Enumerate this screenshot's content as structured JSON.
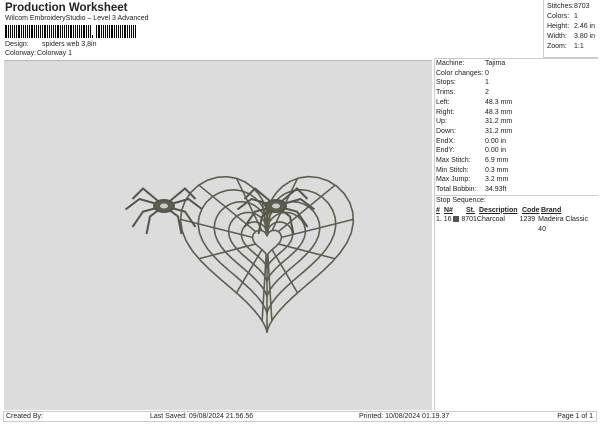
{
  "header": {
    "title": "Production Worksheet",
    "subtitle": "Wilcom EmbroideryStudio – Level 3 Advanced",
    "design_label": "Design:",
    "design_value": "spiders web 3,8in",
    "colorway_label": "Colorway:",
    "colorway_value": "Colorway 1"
  },
  "summary": [
    {
      "label": "Stitches:",
      "value": "8703"
    },
    {
      "label": "Colors:",
      "value": "1"
    },
    {
      "label": "Height:",
      "value": "2.46 in"
    },
    {
      "label": "Width:",
      "value": "3.80 in"
    },
    {
      "label": "Zoom:",
      "value": "1:1"
    }
  ],
  "details": [
    {
      "label": "Machine:",
      "value": "Tajima"
    },
    {
      "label": "Color changes:",
      "value": "0"
    },
    {
      "label": "Stops:",
      "value": "1"
    },
    {
      "label": "Trims:",
      "value": "2"
    },
    {
      "label": "Left:",
      "value": "48.3 mm"
    },
    {
      "label": "Right:",
      "value": "48.3 mm"
    },
    {
      "label": "Up:",
      "value": "31.2 mm"
    },
    {
      "label": "Down:",
      "value": "31.2 mm"
    },
    {
      "label": "EndX:",
      "value": "0.00 in"
    },
    {
      "label": "EndY:",
      "value": "0.00 in"
    },
    {
      "label": "Max Stitch:",
      "value": "6.9 mm"
    },
    {
      "label": "Min Stitch:",
      "value": "0.3 mm"
    },
    {
      "label": "Max Jump:",
      "value": "3.2 mm"
    },
    {
      "label": "Total Bobbin:",
      "value": "34.93ft"
    }
  ],
  "stop_sequence": {
    "title": "Stop Sequence:",
    "headers": [
      "#",
      "N#",
      "St.",
      "Description",
      "Code",
      "Brand"
    ],
    "rows": [
      {
        "num": "1.",
        "needle": "16",
        "swatch": "#555555",
        "stitches": "8701",
        "description": "Charcoal",
        "code": "1239",
        "brand": "Madeira Classic 40"
      }
    ]
  },
  "footer": {
    "created_by": "Created By:",
    "last_saved": "Last Saved: 09/08/2024 21.56.56",
    "printed": "Printed: 10/08/2024 01.19.37",
    "page": "Page 1 of 1"
  },
  "colors": {
    "thread": "#5e5e50",
    "canvas": "#dcdcdc"
  }
}
